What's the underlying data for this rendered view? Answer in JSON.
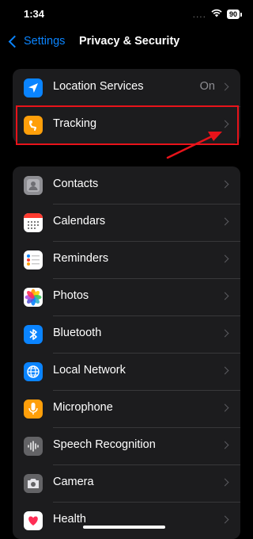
{
  "status": {
    "time": "1:34",
    "signal_dots": "....",
    "wifi_glyph": "ᯤ",
    "battery": "90"
  },
  "nav": {
    "back_label": "Settings",
    "title": "Privacy & Security"
  },
  "group1": [
    {
      "label": "Location Services",
      "value": "On",
      "icon": "location-arrow-icon",
      "color": "#0a84ff"
    },
    {
      "label": "Tracking",
      "value": "",
      "icon": "tracking-icon",
      "color": "#ff9f0a"
    }
  ],
  "group2": [
    {
      "label": "Contacts",
      "icon": "contacts-icon",
      "color": "#8e8e93"
    },
    {
      "label": "Calendars",
      "icon": "calendar-icon",
      "color": "#ffffff"
    },
    {
      "label": "Reminders",
      "icon": "reminders-icon",
      "color": "#ffffff"
    },
    {
      "label": "Photos",
      "icon": "photos-icon",
      "color": "#ffffff"
    },
    {
      "label": "Bluetooth",
      "icon": "bluetooth-icon",
      "color": "#0a84ff"
    },
    {
      "label": "Local Network",
      "icon": "globe-icon",
      "color": "#0a84ff"
    },
    {
      "label": "Microphone",
      "icon": "microphone-icon",
      "color": "#ff9f0a"
    },
    {
      "label": "Speech Recognition",
      "icon": "waveform-icon",
      "color": "#636366"
    },
    {
      "label": "Camera",
      "icon": "camera-icon",
      "color": "#636366"
    },
    {
      "label": "Health",
      "icon": "health-icon",
      "color": "#ffffff"
    }
  ],
  "annotation": {
    "highlight_color": "#e8131a"
  }
}
